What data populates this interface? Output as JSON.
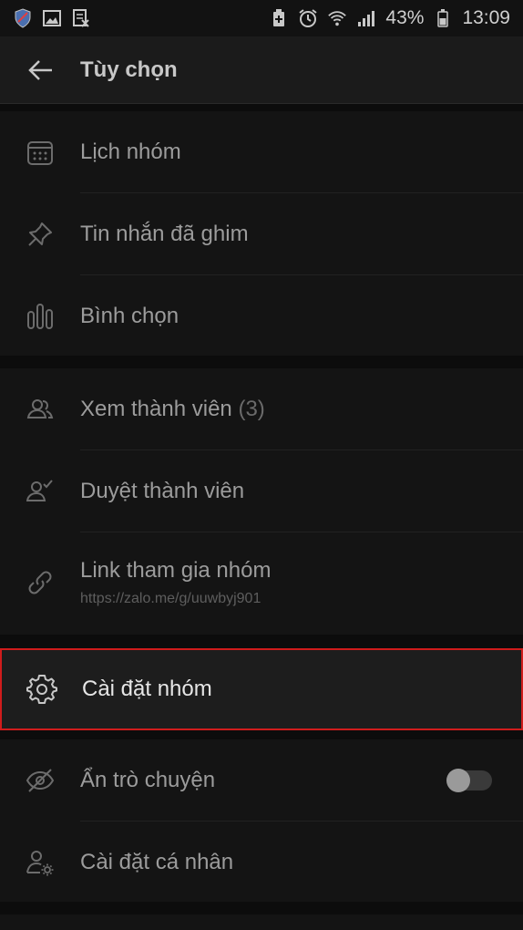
{
  "status_bar": {
    "battery_percent": "43%",
    "time": "13:09"
  },
  "header": {
    "title": "Tùy chọn"
  },
  "section1": {
    "items": [
      {
        "label": "Lịch nhóm",
        "icon": "calendar-icon"
      },
      {
        "label": "Tin nhắn đã ghim",
        "icon": "pin-icon"
      },
      {
        "label": "Bình chọn",
        "icon": "poll-icon"
      }
    ]
  },
  "section2": {
    "view_members": {
      "label": "Xem thành viên",
      "count": "(3)",
      "icon": "members-icon"
    },
    "approve_members": {
      "label": "Duyệt thành viên",
      "icon": "approve-members-icon"
    },
    "join_link": {
      "label": "Link tham gia nhóm",
      "url": "https://zalo.me/g/uuwbyj901",
      "icon": "link-icon"
    }
  },
  "group_settings": {
    "label": "Cài đặt nhóm",
    "icon": "gear-icon"
  },
  "section3": {
    "hide_chat": {
      "label": "Ẩn trò chuyện",
      "toggle_on": false,
      "icon": "eye-off-icon"
    },
    "personal_settings": {
      "label": "Cài đặt cá nhân",
      "icon": "user-settings-icon"
    }
  },
  "colors": {
    "background": "#0c0c0c",
    "highlight_border": "#d01c1c"
  }
}
